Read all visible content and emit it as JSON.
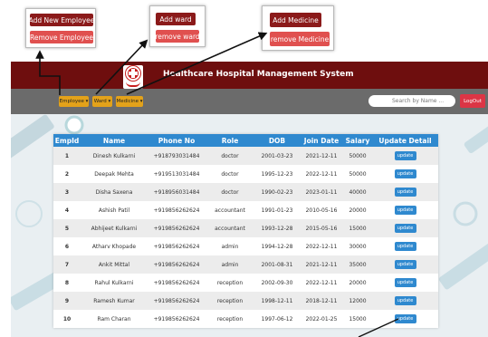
{
  "callouts": {
    "employee": {
      "add_label": "Add New Employee",
      "remove_label": "Remove Employee"
    },
    "ward": {
      "add_label": "Add ward",
      "remove_label": "remove ward"
    },
    "medicine": {
      "add_label": "Add Medicine",
      "remove_label": "remove Medicine"
    }
  },
  "header": {
    "title": "Healthcare Hospital Management System"
  },
  "navbar": {
    "employee_label": "Employee ▾",
    "ward_label": "Ward ▾",
    "medicine_label": "Medicine ▾",
    "search_placeholder": "Search by Name ...",
    "logout_label": "LogOut"
  },
  "table": {
    "columns": [
      "EmpId",
      "Name",
      "Phone No",
      "Role",
      "DOB",
      "Join Date",
      "Salary",
      "Update Detail"
    ],
    "update_label": "update",
    "rows": [
      [
        "1",
        "Dinesh Kulkarni",
        "+918793031484",
        "doctor",
        "2001-03-23",
        "2021-12-11",
        "50000"
      ],
      [
        "2",
        "Deepak Mehta",
        "+919513031484",
        "doctor",
        "1995-12-23",
        "2022-12-11",
        "50000"
      ],
      [
        "3",
        "Disha Saxena",
        "+918956031484",
        "doctor",
        "1990-02-23",
        "2023-01-11",
        "40000"
      ],
      [
        "4",
        "Ashish Patil",
        "+919856262624",
        "accountant",
        "1991-01-23",
        "2010-05-16",
        "20000"
      ],
      [
        "5",
        "Abhijeet Kulkarni",
        "+919856262624",
        "accountant",
        "1993-12-28",
        "2015-05-16",
        "15000"
      ],
      [
        "6",
        "Atharv Khopade",
        "+919856262624",
        "admin",
        "1994-12-28",
        "2022-12-11",
        "30000"
      ],
      [
        "7",
        "Ankit Mittal",
        "+919856262624",
        "admin",
        "2001-08-31",
        "2021-12-11",
        "35000"
      ],
      [
        "8",
        "Rahul Kulkarni",
        "+919856262624",
        "reception",
        "2002-09-30",
        "2022-12-11",
        "20000"
      ],
      [
        "9",
        "Ramesh Kumar",
        "+919856262624",
        "reception",
        "1998-12-11",
        "2018-12-11",
        "12000"
      ],
      [
        "10",
        "Ram Charan",
        "+919856262624",
        "reception",
        "1997-06-12",
        "2022-01-25",
        "15000"
      ]
    ]
  },
  "colors": {
    "header_bg": "#6e0e0e",
    "nav_bg": "#6b6b6b",
    "nav_button": "#e3a21a",
    "table_header": "#2f89cf",
    "logout": "#dc3545"
  },
  "icons": [
    "hospital-logo-icon"
  ]
}
